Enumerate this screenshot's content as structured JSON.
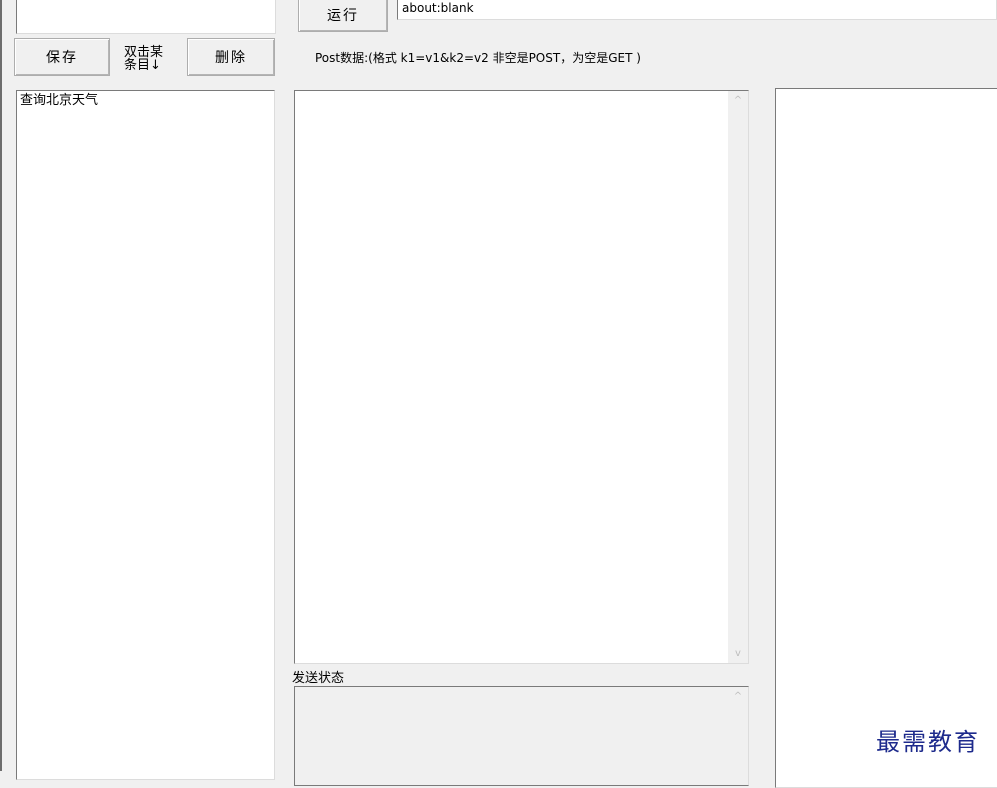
{
  "top": {
    "name_input_value": "",
    "run_button": "运行",
    "url_value": "about:blank"
  },
  "toolbar": {
    "save_button": "保存",
    "hint_line1": "双击某",
    "hint_line2": "条目↓",
    "delete_button": "删除",
    "post_label": "Post数据:(格式 k1=v1&k2=v2 非空是POST，为空是GET )"
  },
  "saved_list": {
    "items": [
      "查询北京天气"
    ]
  },
  "status": {
    "label": "发送状态"
  },
  "watermark": {
    "text": "最需教育"
  },
  "icons": {
    "scroll_up": "scroll-up-arrow",
    "scroll_down": "scroll-down-arrow"
  }
}
